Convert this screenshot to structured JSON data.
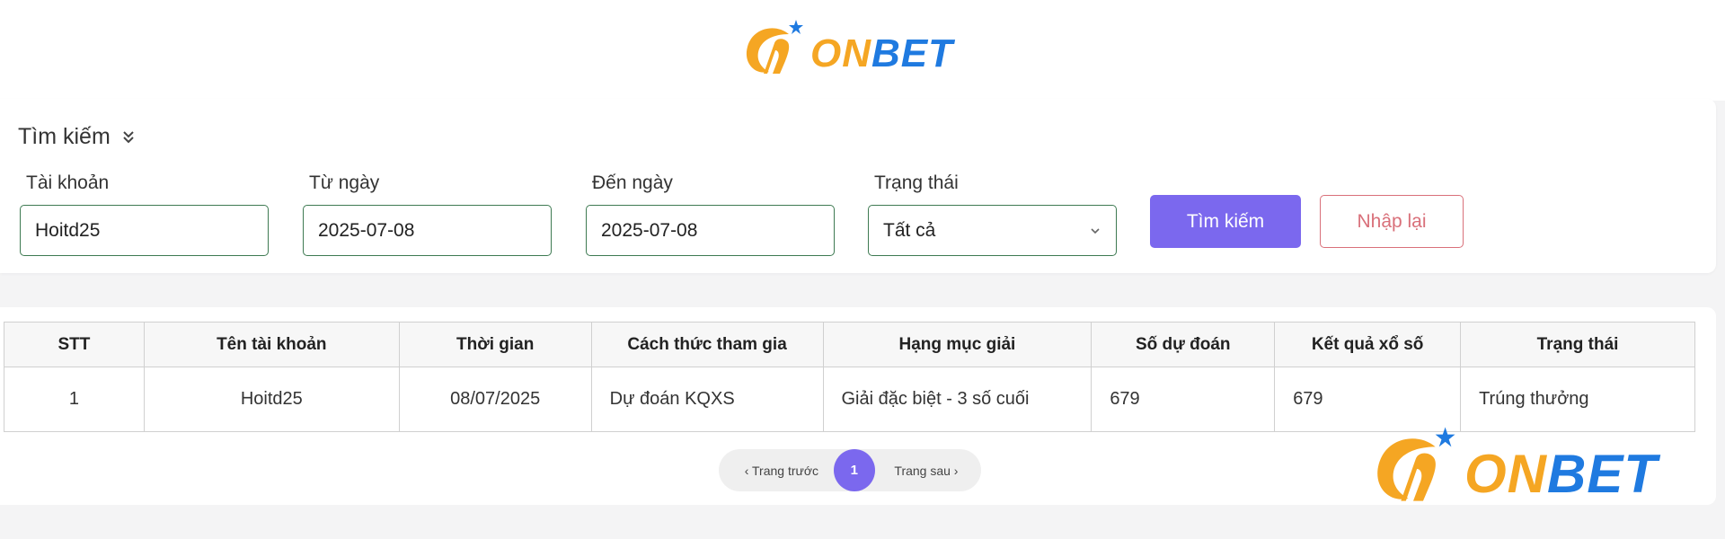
{
  "brand": {
    "on": "ON",
    "bet": "BET",
    "on_color": "#f5a623",
    "bet_color": "#1f7ae0",
    "icon": "onbet-swirl-logo"
  },
  "search": {
    "title": "Tìm kiếm",
    "fields": [
      {
        "label": "Tài khoản",
        "value": "Hoitd25"
      },
      {
        "label": "Từ ngày",
        "value": "2025-07-08"
      },
      {
        "label": "Đến ngày",
        "value": "2025-07-08"
      },
      {
        "label": "Trạng thái",
        "value": "Tất cả"
      }
    ],
    "search_button": "Tìm kiếm",
    "reset_button": "Nhập lại",
    "accent_color": "#7b68ee",
    "reset_color": "#d9707a"
  },
  "table": {
    "headers": [
      "STT",
      "Tên tài khoản",
      "Thời gian",
      "Cách thức tham gia",
      "Hạng mục giải",
      "Số dự đoán",
      "Kết quả xổ số",
      "Trạng thái"
    ],
    "rows": [
      [
        "1",
        "Hoitd25",
        "08/07/2025",
        "Dự đoán KQXS",
        "Giải đặc biệt - 3 số cuối",
        "679",
        "679",
        "Trúng thưởng"
      ]
    ]
  },
  "pagination": {
    "prev": "‹ Trang trước",
    "current": "1",
    "next": "Trang sau ›"
  }
}
